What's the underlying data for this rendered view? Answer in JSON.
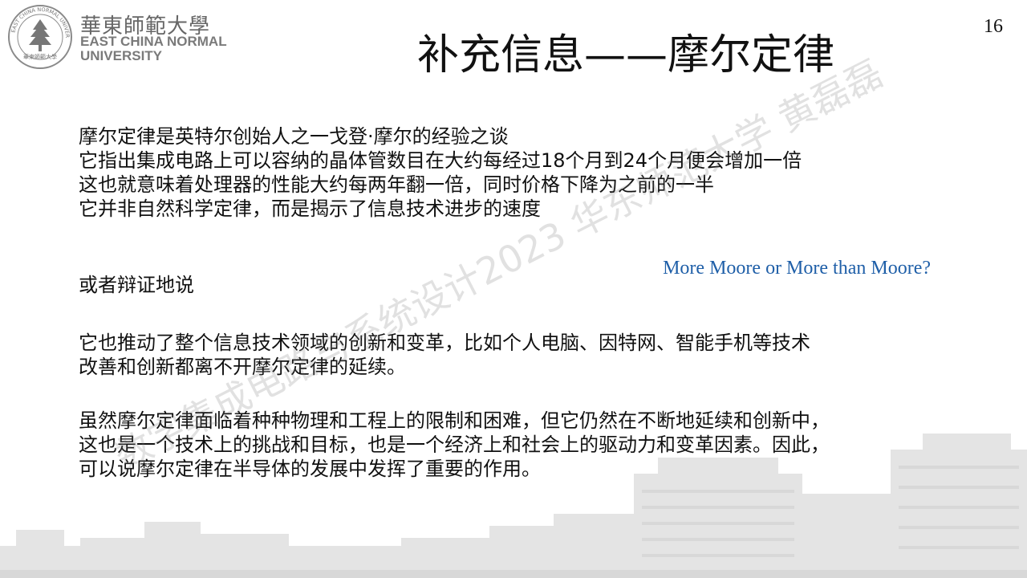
{
  "header": {
    "logo": {
      "chinese_name": "華東師範大學",
      "english_line1": "EAST CHINA NORMAL",
      "english_line2": "UNIVERSITY",
      "seal_ring_text": "EAST CHINA NORMAL UNIVERSITY",
      "seal_bottom_text": "華東師範大學",
      "seal_icon": "pine-tree-icon"
    },
    "page_number": "16"
  },
  "slide": {
    "title": "补充信息——摩尔定律",
    "block1": [
      "摩尔定律是英特尔创始人之一戈登·摩尔的经验之谈",
      "它指出集成电路上可以容纳的晶体管数目在大约每经过18个月到24个月便会增加一倍",
      "这也就意味着处理器的性能大约每两年翻一倍，同时价格下降为之前的一半",
      "它并非自然科学定律，而是揭示了信息技术进步的速度"
    ],
    "block2": [
      "或者辩证地说"
    ],
    "callout": "More Moore or More than Moore?",
    "block3": [
      "它也推动了整个信息技术领域的创新和变革，比如个人电脑、因特网、智能手机等技术",
      "改善和创新都离不开摩尔定律的延续。"
    ],
    "block4": [
      "虽然摩尔定律面临着种种物理和工程上的限制和困难，但它仍然在不断地延续和创新中，",
      "这也是一个技术上的挑战和目标，也是一个经济上和社会上的驱动力和变革因素。因此，",
      "可以说摩尔定律在半导体的发展中发挥了重要的作用。"
    ],
    "watermark": "数字集成电路与系统设计2023 华东师范大学 黄磊磊"
  },
  "colors": {
    "text": "#111111",
    "callout": "#1f5fa8",
    "logo_gray": "#7a7a7a"
  }
}
